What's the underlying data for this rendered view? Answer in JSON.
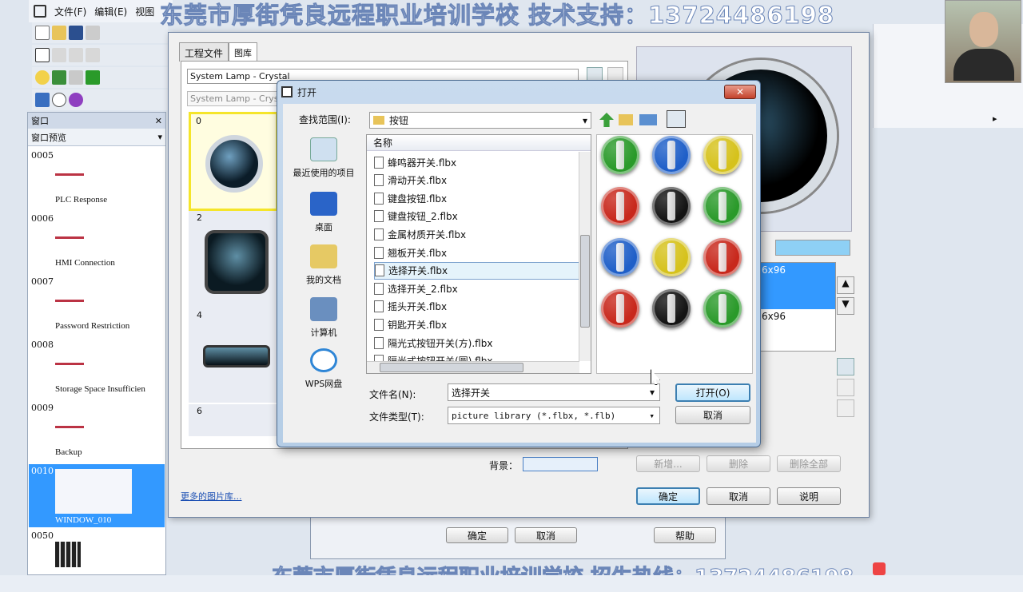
{
  "watermark": {
    "top": "东莞市厚街凭良远程职业培训学校  技术支持：13724486198",
    "bottom": "东莞市厚街凭良远程职业培训学校  招生热线：13724486198"
  },
  "main_menu": [
    "文件(F)",
    "编辑(E)",
    "视图"
  ],
  "window_panel": {
    "title": "窗口",
    "dropdown": "窗口预览",
    "items": [
      {
        "num": "0005",
        "label": "PLC Response"
      },
      {
        "num": "0006",
        "label": "HMI Connection"
      },
      {
        "num": "0007",
        "label": "Password Restriction"
      },
      {
        "num": "0008",
        "label": "Storage Space Insufficien"
      },
      {
        "num": "0009",
        "label": "Backup"
      },
      {
        "num": "0010",
        "label": "WINDOW_010"
      },
      {
        "num": "0050",
        "label": ""
      }
    ]
  },
  "picture_dialog": {
    "tabs": [
      "工程文件",
      "图库"
    ],
    "library": "System Lamp - Crystal",
    "library2": "System Lamp - Crystal",
    "thumbs": [
      "0",
      "2",
      "4",
      "6"
    ],
    "size_items": [
      "6x96",
      "6x96"
    ],
    "background_label": "背景：",
    "buttons": {
      "new": "新增...",
      "delete": "删除",
      "delete_all": "删除全部",
      "ok": "确定",
      "cancel": "取消",
      "help": "说明"
    },
    "more_link": "更多的图片库..."
  },
  "outer_buttons": {
    "ok": "确定",
    "cancel": "取消",
    "help": "帮助"
  },
  "open_dialog": {
    "title": "打开",
    "lookin_label": "查找范围(I):",
    "lookin_value": "按钮",
    "column": "名称",
    "places": [
      "最近使用的项目",
      "桌面",
      "我的文档",
      "计算机",
      "WPS网盘"
    ],
    "files": [
      "蜂鸣器开关.flbx",
      "滑动开关.flbx",
      "键盘按钮.flbx",
      "键盘按钮_2.flbx",
      "金属材质开关.flbx",
      "翘板开关.flbx",
      "选择开关.flbx",
      "选择开关_2.flbx",
      "摇头开关.flbx",
      "钥匙开关.flbx",
      "隔光式按钮开关(方).flbx",
      "隔光式按钮开关(圆).flbx"
    ],
    "selected_index": 6,
    "filename_label": "文件名(N):",
    "filename_value": "选择开关",
    "filetype_label": "文件类型(T):",
    "filetype_value": "picture library (*.flbx, *.flb)",
    "open_btn": "打开(O)",
    "cancel_btn": "取消",
    "preview_colors": [
      "#2a9a2a",
      "#1f5fc8",
      "#d6c21c",
      "#c8281c",
      "#141414",
      "#2a9a2a",
      "#1f5fc8",
      "#d6c21c",
      "#c8281c",
      "#c8281c",
      "#141414",
      "#2a9a2a"
    ]
  },
  "colors": {
    "selection": "#3399ff",
    "title_blue": "#2a6bb8"
  }
}
